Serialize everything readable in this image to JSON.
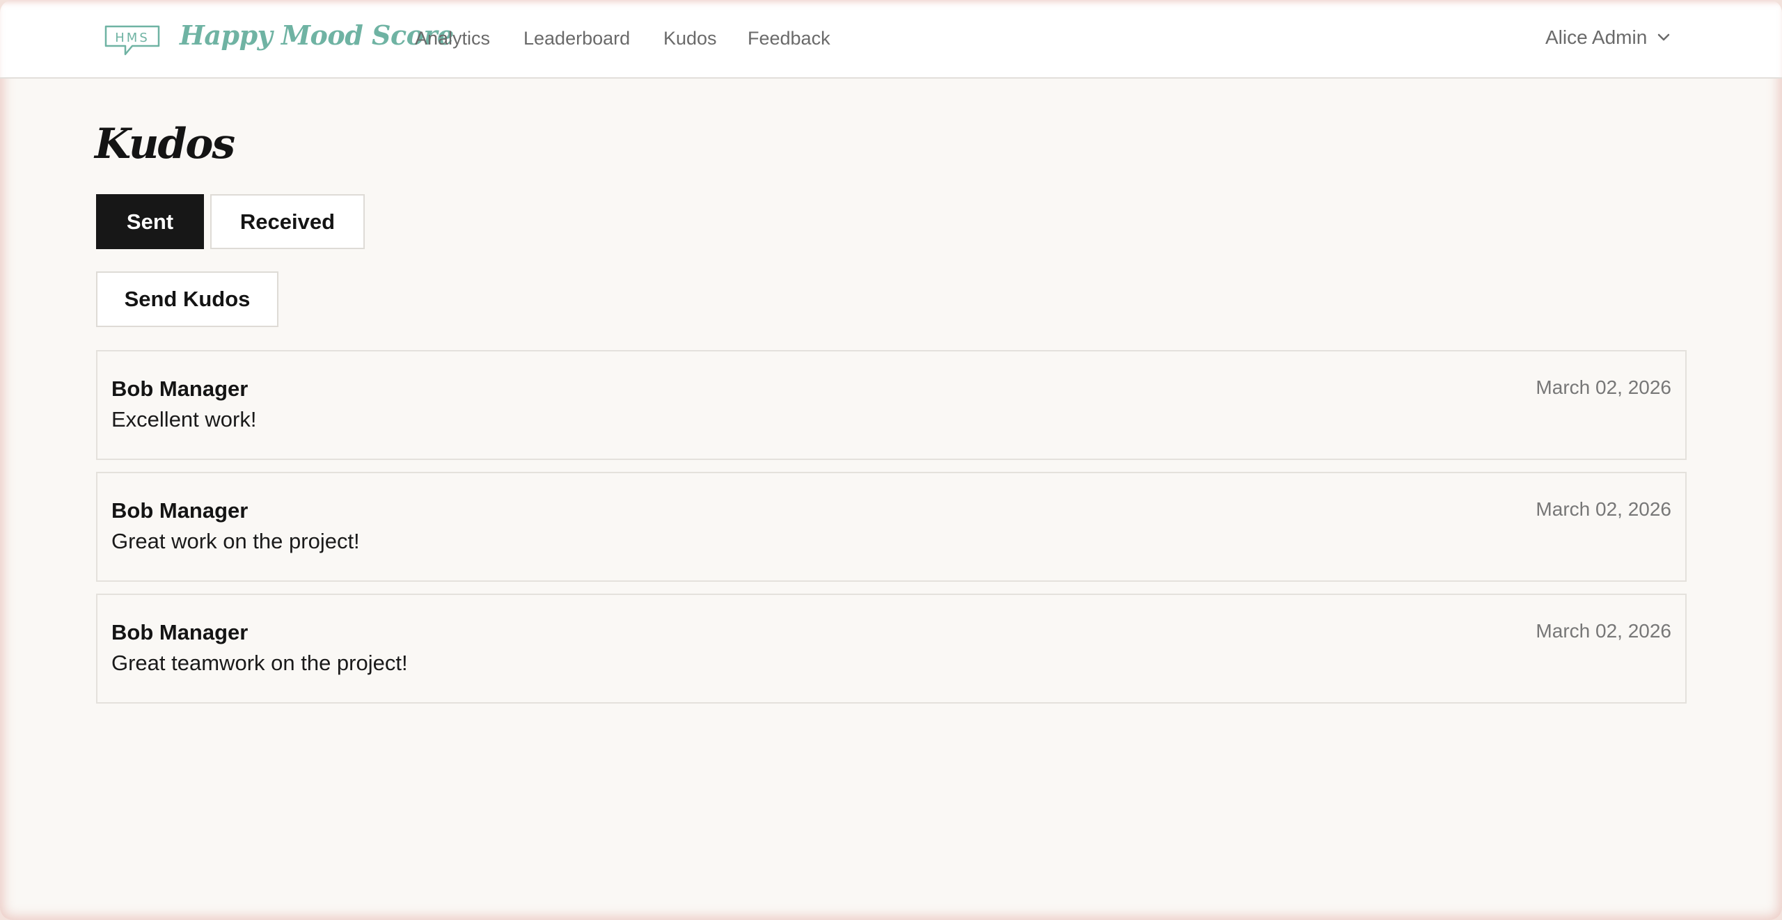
{
  "header": {
    "logo_text": "HMS",
    "brand": "Happy Mood Score",
    "nav": [
      {
        "label": "Analytics"
      },
      {
        "label": "Leaderboard"
      },
      {
        "label": "Kudos"
      },
      {
        "label": "Feedback"
      }
    ],
    "user": {
      "name": "Alice Admin",
      "icon": "chevron-down-icon"
    }
  },
  "main": {
    "title": "Kudos",
    "tabs": [
      {
        "label": "Sent",
        "active": true
      },
      {
        "label": "Received",
        "active": false
      }
    ],
    "send_button": "Send Kudos",
    "kudos": [
      {
        "name": "Bob Manager",
        "message": "Excellent work!",
        "date": "March 02, 2026"
      },
      {
        "name": "Bob Manager",
        "message": "Great work on the project!",
        "date": "March 02, 2026"
      },
      {
        "name": "Bob Manager",
        "message": "Great teamwork on the project!",
        "date": "March 02, 2026"
      }
    ]
  },
  "colors": {
    "brand": "#6fb3a3",
    "active_tab": "#171717",
    "background": "#faf8f5"
  }
}
